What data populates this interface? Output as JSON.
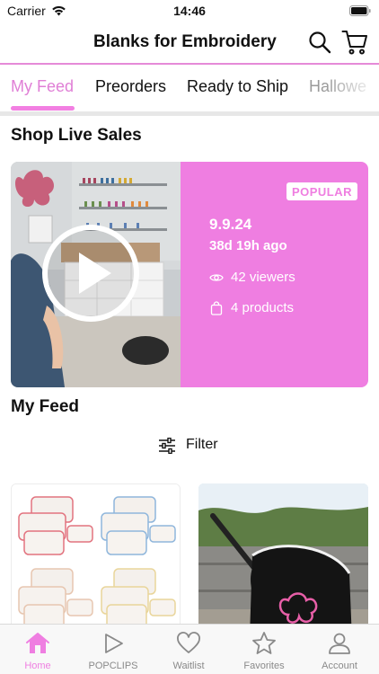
{
  "status_bar": {
    "carrier": "Carrier",
    "time": "14:46"
  },
  "header": {
    "title": "Blanks for Embroidery"
  },
  "tabs": [
    {
      "label": "My Feed",
      "active": true
    },
    {
      "label": "Preorders",
      "active": false
    },
    {
      "label": "Ready to Ship",
      "active": false
    },
    {
      "label": "Hallowe",
      "active": false
    }
  ],
  "live_sales": {
    "title": "Shop Live Sales",
    "card": {
      "badge": "POPULAR",
      "date": "9.9.24",
      "ago": "38d 19h ago",
      "viewers": "42 viewers",
      "products": "4 products"
    }
  },
  "feed": {
    "title": "My Feed",
    "filter_label": "Filter"
  },
  "bottom_nav": [
    {
      "label": "Home",
      "icon": "home-icon",
      "active": true
    },
    {
      "label": "POPCLIPS",
      "icon": "play-icon",
      "active": false
    },
    {
      "label": "Waitlist",
      "icon": "heart-icon",
      "active": false
    },
    {
      "label": "Favorites",
      "icon": "star-icon",
      "active": false
    },
    {
      "label": "Account",
      "icon": "person-icon",
      "active": false
    }
  ],
  "colors": {
    "accent": "#ef7ee1",
    "accent_text": "#e07fd6",
    "nav_inactive": "#8a8a8a"
  }
}
